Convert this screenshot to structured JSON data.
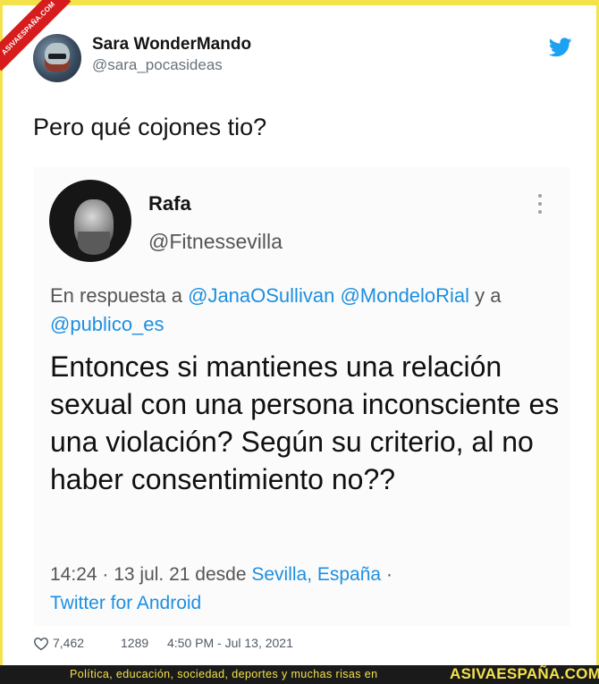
{
  "watermark_corner": "ASIVAESPAÑA.COM",
  "tweet": {
    "display_name": "Sara WonderMando",
    "handle": "@sara_pocasideas",
    "text": "Pero qué cojones tio?",
    "likes": "7,462",
    "retweets": "1289",
    "timestamp": "4:50 PM - Jul 13, 2021",
    "service_icon": "twitter-bird-icon"
  },
  "quoted": {
    "display_name": "Rafa",
    "handle": "@Fitnessevilla",
    "reply_prefix": "En respuesta a ",
    "reply_mentions": [
      "@JanaOSullivan",
      "@MondeloRial"
    ],
    "reply_joiner": " y a",
    "reply_last": "@publico_es",
    "body": "Entonces si mantienes una relación sexual con una persona inconsciente es una violación? Según su criterio, al no haber consentimiento no??",
    "meta_time": "14:24 · 13 jul. 21 desde ",
    "meta_location": "Sevilla, España",
    "meta_sep": " ·",
    "meta_client": "Twitter for Android"
  },
  "footer": {
    "tagline": "Política, educación, sociedad, deportes y muchas risas en",
    "brand": "ASIVAESPAÑA.COM"
  },
  "colors": {
    "accent_yellow": "#f3e24a",
    "link_blue": "#1d8fe0",
    "twitter_blue": "#1da1f2",
    "corner_red": "#d61c1c"
  }
}
